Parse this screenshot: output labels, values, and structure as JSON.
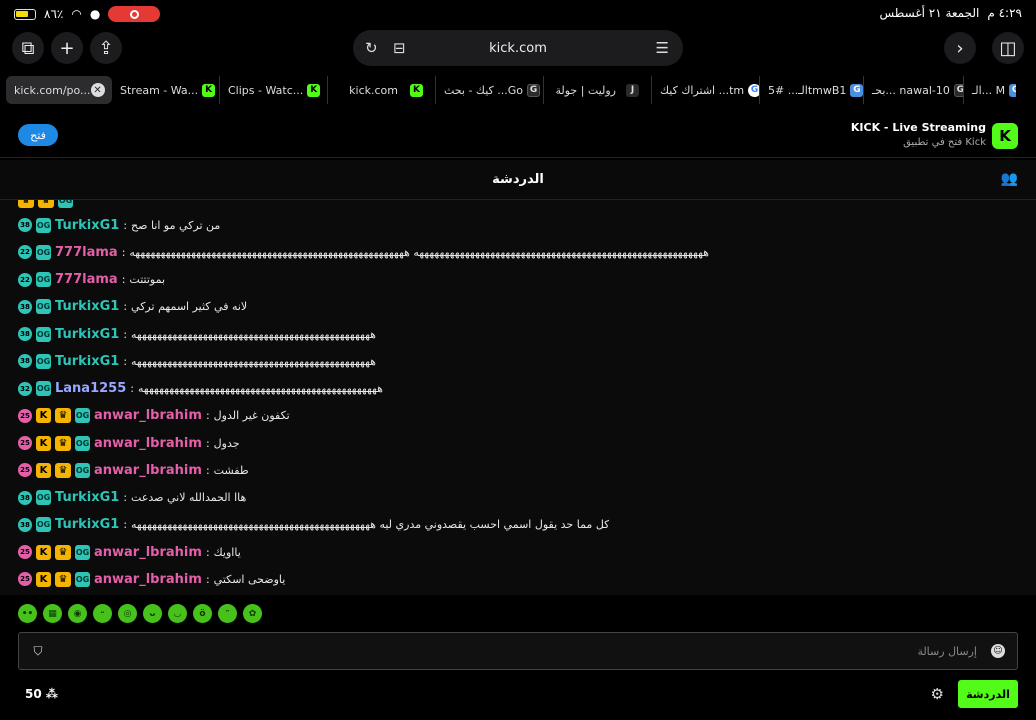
{
  "status_bar": {
    "battery": "٨٦٪",
    "time": "٤:٢٩ م",
    "date": "الجمعة ٢١ أغسطس"
  },
  "browser": {
    "address": "kick.com"
  },
  "tabs": [
    {
      "label": "kick.com/po...",
      "active": true
    },
    {
      "label": "Stream - Wa..."
    },
    {
      "label": "Clips - Watc..."
    },
    {
      "label": "kick.com"
    },
    {
      "label": "كيك - بحث ...Go"
    },
    {
      "label": "روليت | جولة"
    },
    {
      "label": "اشتراك كيك ...tm"
    },
    {
      "label": "الـ... #5tmwB1"
    },
    {
      "label": "بحـ... nawal-10"
    },
    {
      "label": "الـ... M"
    }
  ],
  "banner": {
    "open_label": "فتح",
    "title": "KICK - Live Streaming",
    "subtitle": "فتح في تطبيق Kick"
  },
  "chat": {
    "title": "الدردشة",
    "messages": [
      {
        "user": "TurkixG1",
        "color": "#2ec4b6",
        "badge_num": "38",
        "text": "من تركي مو انا صح"
      },
      {
        "user": "777lama",
        "color": "#e45fa9",
        "badge_num": "22",
        "text": "هههههههههههههههههههههههههههههههههههههههههههههههههههههههههه ههههههههههههههههههههههههههههههههههههههههههههههههههههههه"
      },
      {
        "user": "777lama",
        "color": "#e45fa9",
        "badge_num": "22",
        "text": "بموتتتت"
      },
      {
        "user": "TurkixG1",
        "color": "#2ec4b6",
        "badge_num": "38",
        "text": "لانه في كثير اسمهم تركي"
      },
      {
        "user": "TurkixG1",
        "color": "#2ec4b6",
        "badge_num": "38",
        "text": "هههههههههههههههههههههههههههههههههههههههههههههههه"
      },
      {
        "user": "TurkixG1",
        "color": "#2ec4b6",
        "badge_num": "38",
        "text": "هههههههههههههههههههههههههههههههههههههههههههههههه"
      },
      {
        "user": "Lana1255",
        "color": "#9aa7ff",
        "badge_num": "32",
        "text": "هههههههههههههههههههههههههههههههههههههههههههههههه"
      },
      {
        "user": "anwar_lbrahim",
        "color": "#e45fa9",
        "badge_num": "25",
        "vip": true,
        "text": "تكفون غير الدول"
      },
      {
        "user": "anwar_lbrahim",
        "color": "#e45fa9",
        "badge_num": "25",
        "vip": true,
        "text": "جدول"
      },
      {
        "user": "anwar_lbrahim",
        "color": "#e45fa9",
        "badge_num": "25",
        "vip": true,
        "text": "طفشت"
      },
      {
        "user": "TurkixG1",
        "color": "#2ec4b6",
        "badge_num": "38",
        "text": "هاا الحمدالله لاني صدعت"
      },
      {
        "user": "TurkixG1",
        "color": "#2ec4b6",
        "badge_num": "38",
        "text": "كل مما حد يقول اسمي احسب يقصدوني مدري ليه هههههههههههههههههههههههههههههههههههههههههههههههه"
      },
      {
        "user": "anwar_lbrahim",
        "color": "#e45fa9",
        "badge_num": "25",
        "vip": true,
        "text": "يااويك"
      },
      {
        "user": "anwar_lbrahim",
        "color": "#e45fa9",
        "badge_num": "25",
        "vip": true,
        "text": "ياوضحى اسكتي"
      }
    ],
    "input_placeholder": "إرسال رسالة",
    "send_label": "الدردشة",
    "viewer_count": "50"
  }
}
